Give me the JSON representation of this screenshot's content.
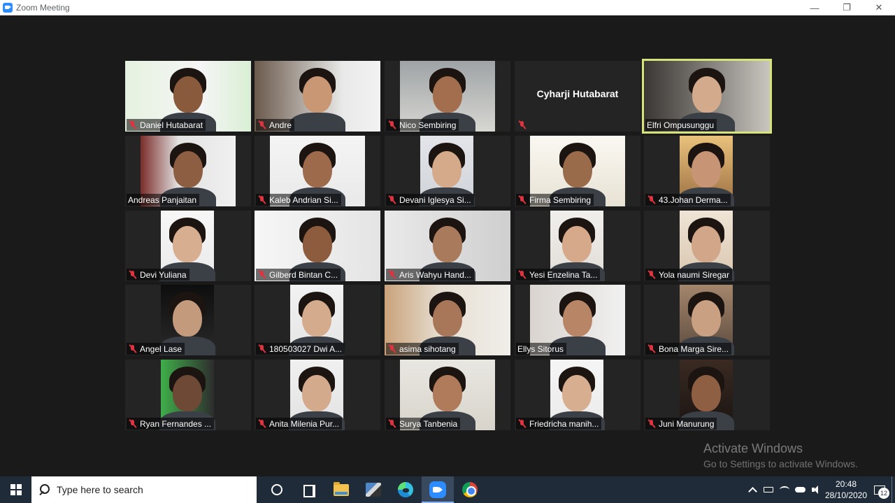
{
  "window": {
    "title": "Zoom Meeting",
    "minimize": "—",
    "restore": "❐",
    "close": "✕"
  },
  "participants": [
    {
      "name": "Daniel Hutabarat",
      "muted": true,
      "video": true,
      "active": false
    },
    {
      "name": "Andre",
      "muted": true,
      "video": true,
      "active": false
    },
    {
      "name": "Nico Sembiring",
      "muted": true,
      "video": true,
      "active": false
    },
    {
      "name": "",
      "display_name": "Cyharji Hutabarat",
      "muted": true,
      "video": false,
      "active": false
    },
    {
      "name": "Elfri Ompusunggu",
      "muted": false,
      "video": true,
      "active": true
    },
    {
      "name": "Andreas Panjaitan",
      "muted": false,
      "video": true,
      "active": false
    },
    {
      "name": "Kaleb Andrian Si...",
      "muted": true,
      "video": true,
      "active": false
    },
    {
      "name": "Devani Iglesya Si...",
      "muted": true,
      "video": true,
      "active": false
    },
    {
      "name": "Firma Sembiring",
      "muted": true,
      "video": true,
      "active": false
    },
    {
      "name": "43.Johan Derma...",
      "muted": true,
      "video": true,
      "active": false
    },
    {
      "name": "Devi Yuliana",
      "muted": true,
      "video": true,
      "active": false
    },
    {
      "name": "Gilberd Bintan C...",
      "muted": true,
      "video": true,
      "active": false
    },
    {
      "name": "Aris Wahyu Hand...",
      "muted": true,
      "video": true,
      "active": false
    },
    {
      "name": "Yesi Enzelina Ta...",
      "muted": true,
      "video": true,
      "active": false
    },
    {
      "name": "Yola naumi Siregar",
      "muted": true,
      "video": true,
      "active": false
    },
    {
      "name": "Angel Lase",
      "muted": true,
      "video": true,
      "active": false
    },
    {
      "name": "180503027 Dwi A...",
      "muted": true,
      "video": true,
      "active": false
    },
    {
      "name": "asima sihotang",
      "muted": true,
      "video": true,
      "active": false
    },
    {
      "name": "Ellys Sitorus",
      "muted": false,
      "video": true,
      "active": false
    },
    {
      "name": "Bona Marga Sire...",
      "muted": true,
      "video": true,
      "active": false
    },
    {
      "name": "Ryan Fernandes ...",
      "muted": true,
      "video": true,
      "active": false
    },
    {
      "name": "Anita Milenia Pur...",
      "muted": true,
      "video": true,
      "active": false
    },
    {
      "name": "Surya Tanbenia",
      "muted": true,
      "video": true,
      "active": false
    },
    {
      "name": "Friedricha manih...",
      "muted": true,
      "video": true,
      "active": false
    },
    {
      "name": "Juni Manurung",
      "muted": true,
      "video": true,
      "active": false
    }
  ],
  "watermark": {
    "title": "Activate Windows",
    "subtitle": "Go to Settings to activate Windows."
  },
  "taskbar": {
    "search_placeholder": "Type here to search",
    "apps": [
      "cortana-icon",
      "task-view-icon",
      "file-explorer-icon",
      "media-app-icon",
      "edge-icon",
      "zoom-icon",
      "chrome-icon"
    ],
    "time": "20:48",
    "date": "28/10/2020",
    "notification_count": "12"
  }
}
